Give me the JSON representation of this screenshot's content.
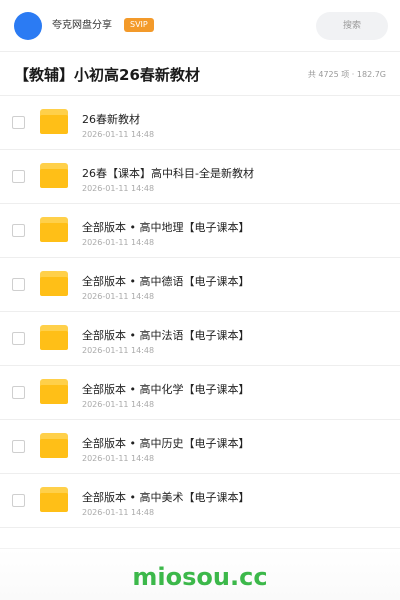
{
  "header": {
    "avatar_icon": "user-avatar-icon",
    "user_name": "夸克网盘分享",
    "vip_label": "SVIP",
    "search_placeholder": "搜索",
    "accent_color": "#2b7bf3",
    "vip_color": "#f39a2a"
  },
  "title_bar": {
    "title": "【教辅】小初高26春新教材",
    "stats": "共 4725 项 · 182.7G"
  },
  "files": [
    {
      "name": "26春新教材",
      "date": "2026-01-11 14:48",
      "icon": "folder-icon"
    },
    {
      "name": "26春【课本】高中科目-全是新教材",
      "date": "2026-01-11 14:48",
      "icon": "folder-icon"
    },
    {
      "name": "全部版本 • 高中地理【电子课本】",
      "date": "2026-01-11 14:48",
      "icon": "folder-icon"
    },
    {
      "name": "全部版本 • 高中德语【电子课本】",
      "date": "2026-01-11 14:48",
      "icon": "folder-icon"
    },
    {
      "name": "全部版本 • 高中法语【电子课本】",
      "date": "2026-01-11 14:48",
      "icon": "folder-icon"
    },
    {
      "name": "全部版本 • 高中化学【电子课本】",
      "date": "2026-01-11 14:48",
      "icon": "folder-icon"
    },
    {
      "name": "全部版本 • 高中历史【电子课本】",
      "date": "2026-01-11 14:48",
      "icon": "folder-icon"
    },
    {
      "name": "全部版本 • 高中美术【电子课本】",
      "date": "2026-01-11 14:48",
      "icon": "folder-icon"
    }
  ],
  "footer": {
    "watermark": "miosou.cc",
    "watermark_color": "#3cb84a"
  }
}
